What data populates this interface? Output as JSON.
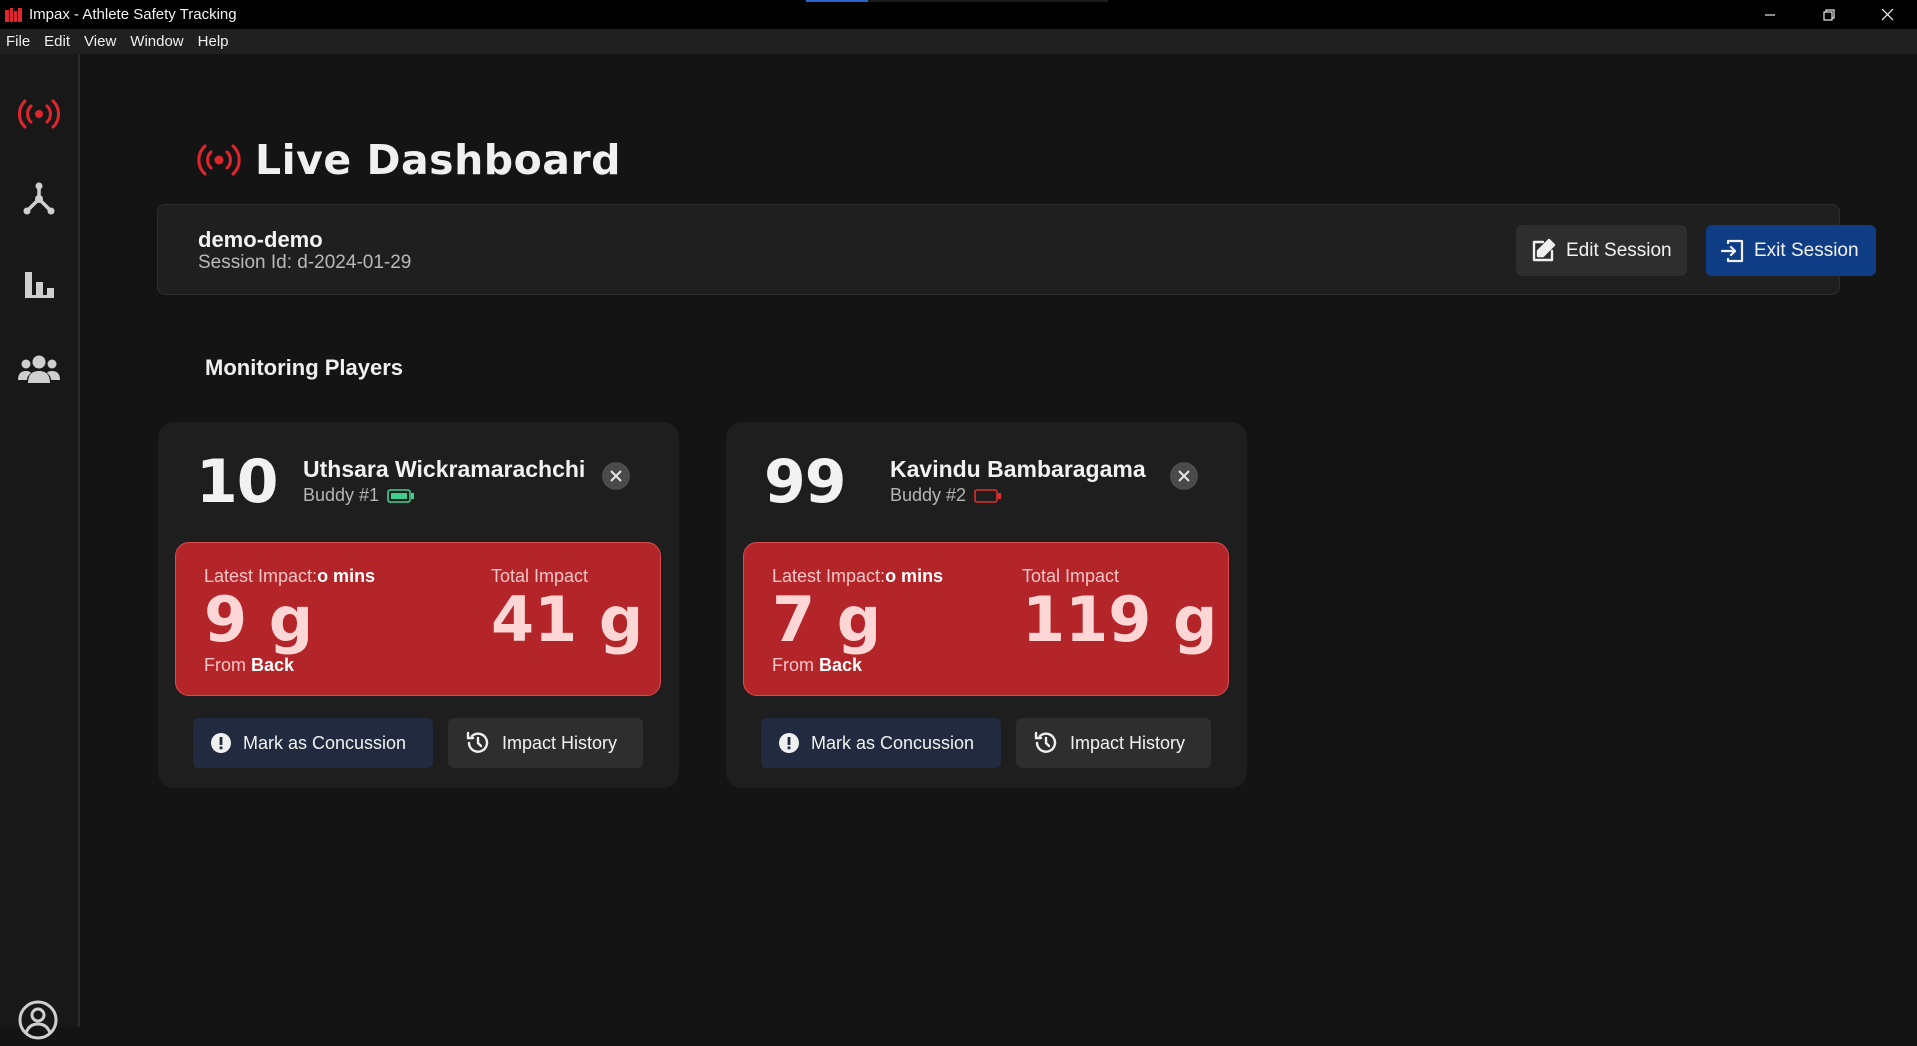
{
  "window": {
    "title": "Impax - Athlete Safety Tracking",
    "controls": [
      "minimize-icon",
      "restore-icon",
      "close-icon"
    ]
  },
  "menu": [
    "File",
    "Edit",
    "View",
    "Window",
    "Help"
  ],
  "sidebar": {
    "items": [
      {
        "icon": "broadcast-icon",
        "active": true
      },
      {
        "icon": "network-icon",
        "active": false
      },
      {
        "icon": "bar-chart-icon",
        "active": false
      },
      {
        "icon": "users-icon",
        "active": false
      }
    ],
    "bottom": {
      "icon": "user-circle-icon"
    }
  },
  "page": {
    "title": "Live Dashboard"
  },
  "session": {
    "name": "demo-demo",
    "id_label": "Session Id: d-2024-01-29",
    "edit_label": "Edit Session",
    "exit_label": "Exit Session"
  },
  "section": {
    "title": "Monitoring Players"
  },
  "players": [
    {
      "number": "10",
      "name": "Uthsara Wickramarachchi",
      "buddy": "Buddy #1",
      "battery": "charged",
      "latest_label": "Latest Impact:",
      "latest_time": "o mins",
      "latest_value": "9 g",
      "from_label": "From",
      "from_dir": "Back",
      "total_label": "Total Impact",
      "total_value": "41 g",
      "concussion_label": "Mark as Concussion",
      "history_label": "Impact History"
    },
    {
      "number": "99",
      "name": "Kavindu Bambaragama",
      "buddy": "Buddy #2",
      "battery": "empty",
      "latest_label": "Latest Impact:",
      "latest_time": "o mins",
      "latest_value": "7 g",
      "from_label": "From",
      "from_dir": "Back",
      "total_label": "Total Impact",
      "total_value": "119 g",
      "concussion_label": "Mark as Concussion",
      "history_label": "Impact History"
    }
  ],
  "colors": {
    "accent_red": "#e0262d",
    "impact_box": "#b4252a",
    "exit_button": "#0e3d86",
    "battery_ok": "#3ecf8e",
    "battery_empty": "#d9302f"
  }
}
